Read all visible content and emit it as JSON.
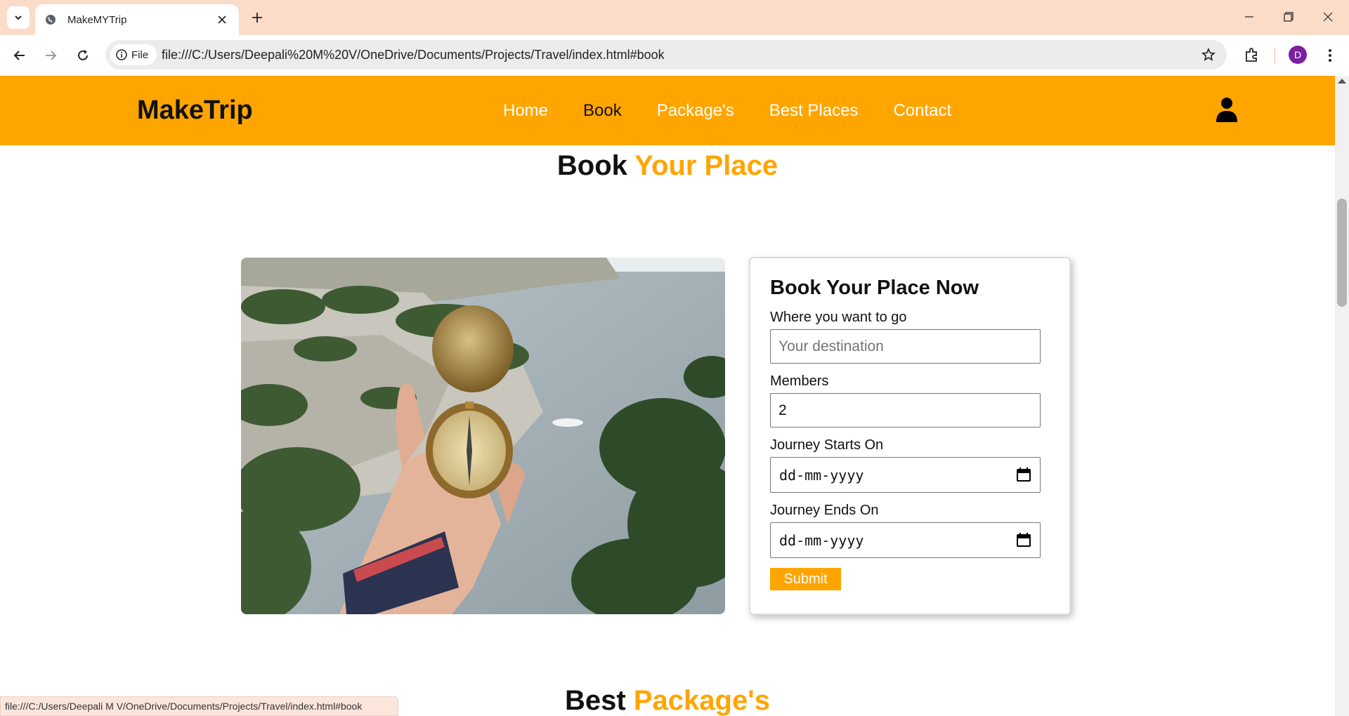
{
  "browser": {
    "tab_title": "MakeMYTrip",
    "site_info_label": "File",
    "url": "file:///C:/Users/Deepali%20M%20V/OneDrive/Documents/Projects/Travel/index.html#book",
    "profile_initial": "D",
    "status_url": "file:///C:/Users/Deepali M V/OneDrive/Documents/Projects/Travel/index.html#book"
  },
  "site": {
    "logo": "MakeTrip",
    "nav": [
      {
        "label": "Home"
      },
      {
        "label": "Book"
      },
      {
        "label": "Package's"
      },
      {
        "label": "Best Places"
      },
      {
        "label": "Contact"
      }
    ],
    "active_nav": "Book",
    "accent_color": "#ffa500"
  },
  "book_section": {
    "heading_plain": "Book",
    "heading_accent": "Your Place",
    "form": {
      "title": "Book Your Place Now",
      "destination_label": "Where you want to go",
      "destination_placeholder": "Your destination",
      "members_label": "Members",
      "members_value": "2",
      "start_label": "Journey Starts On",
      "start_value": "dd-mm-yyyy",
      "end_label": "Journey Ends On",
      "end_value": "dd-mm-yyyy",
      "submit_label": "Submit"
    }
  },
  "packages_section": {
    "heading_plain": "Best",
    "heading_accent": "Package's"
  }
}
